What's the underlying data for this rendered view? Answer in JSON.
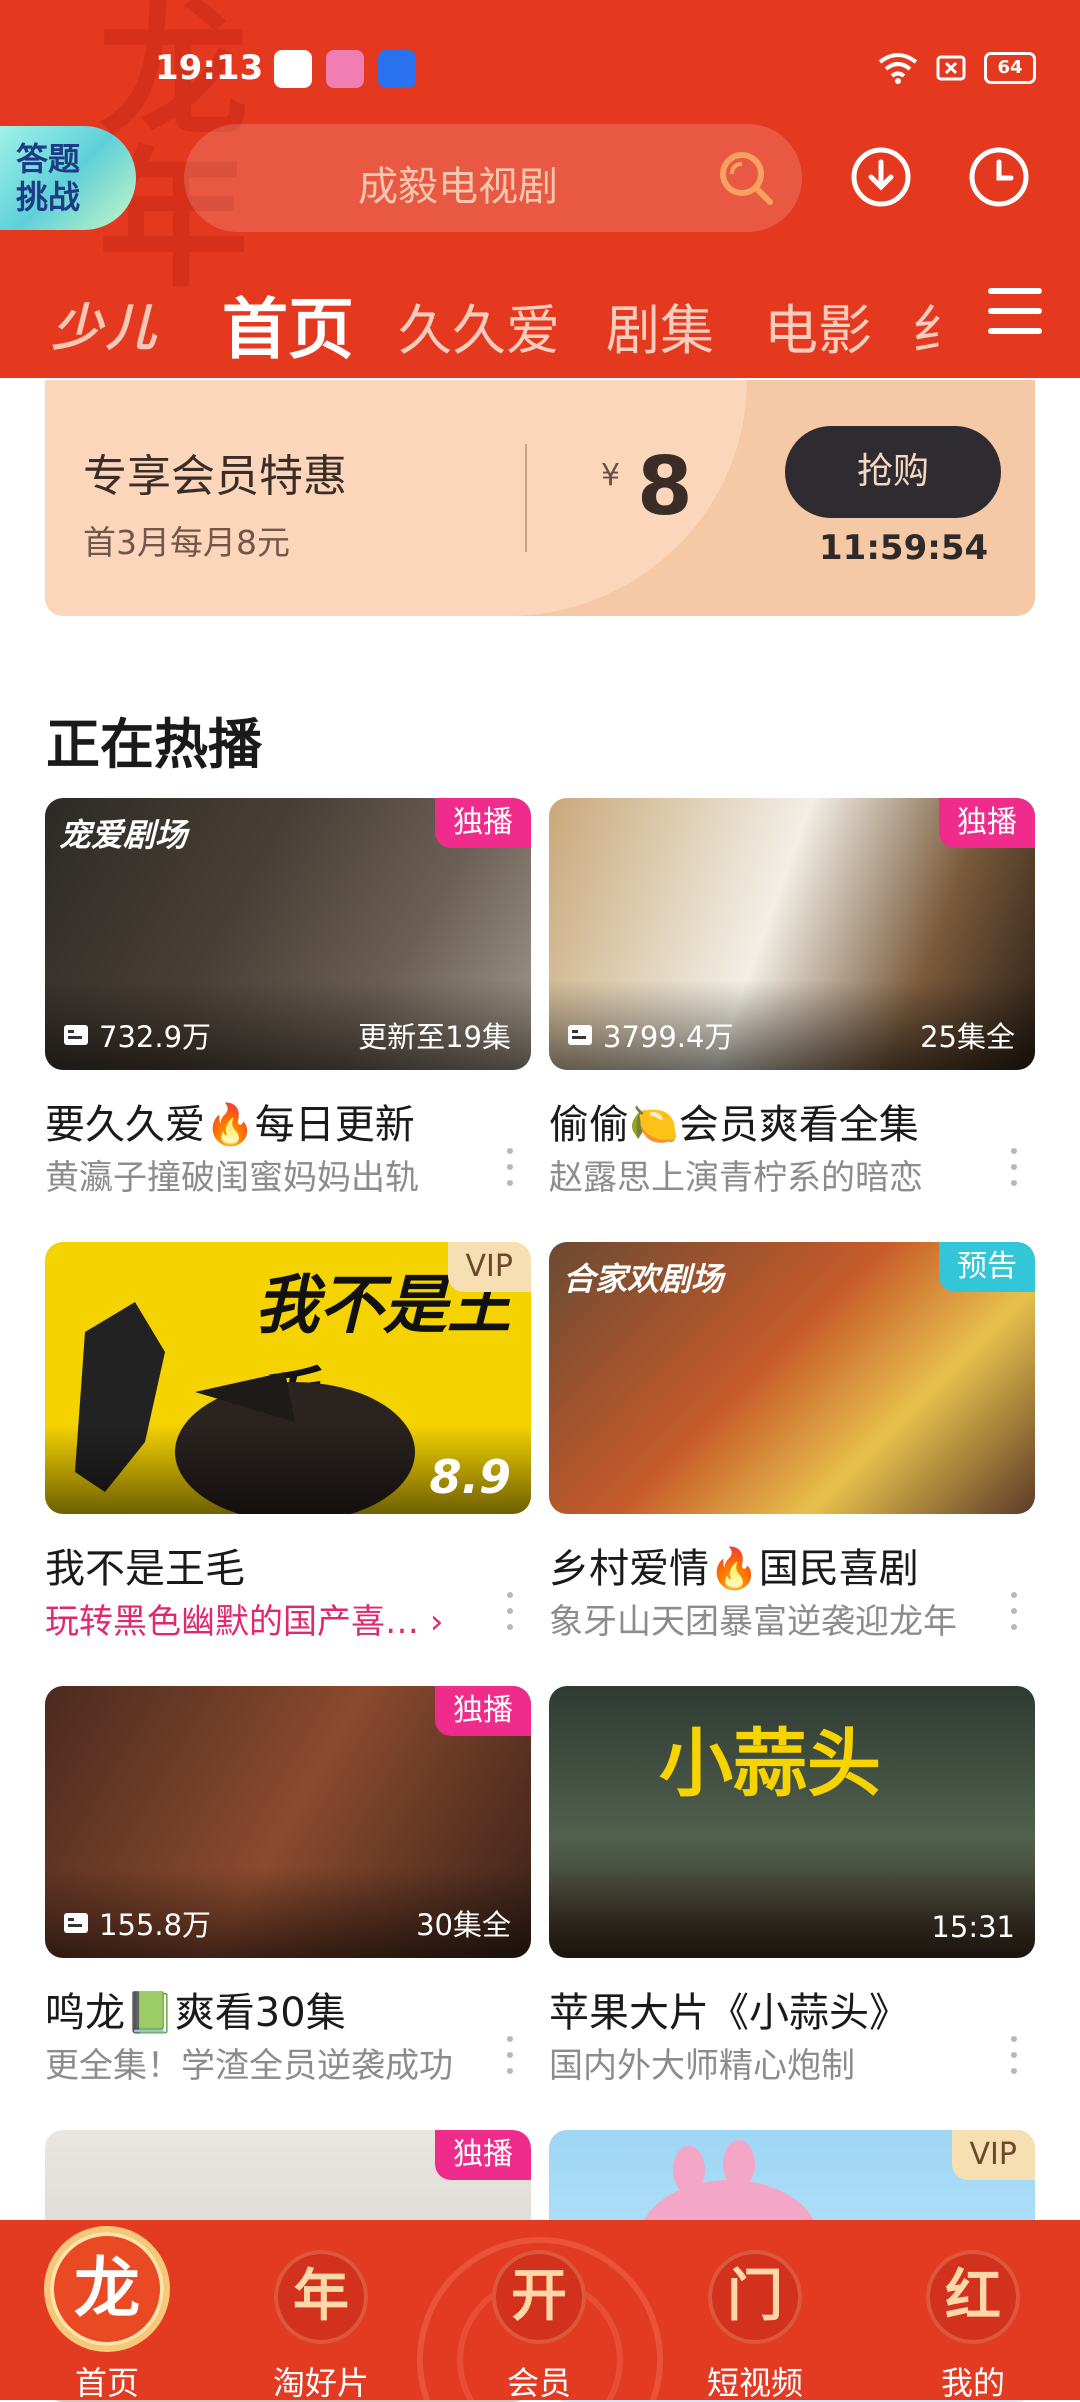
{
  "status_bar": {
    "time": "19:13",
    "battery": "64",
    "icons": [
      "wifi-icon",
      "sim-off-icon",
      "battery-icon"
    ]
  },
  "header": {
    "quiz_badge": [
      "答题",
      "挑战"
    ],
    "search_placeholder": "成毅电视剧",
    "logo": "少儿",
    "tabs": [
      "首页",
      "久久爱",
      "剧集",
      "电影",
      "纟"
    ],
    "active_tab": 0
  },
  "vip_banner": {
    "title": "专享会员特惠",
    "subtitle": "首3月每月8元",
    "price_symbol": "¥",
    "price": "8",
    "buy_label": "抢购",
    "countdown": "11:59:54"
  },
  "section_title": "正在热播",
  "cards": [
    {
      "badge": "独播",
      "views": "732.9万",
      "status": "更新至19集",
      "title": "要久久爱🔥每日更新",
      "subtitle": "黄瀛子撞破闺蜜妈妈出轨",
      "overlay": "宠爱剧场"
    },
    {
      "badge": "独播",
      "views": "3799.4万",
      "status": "25集全",
      "title": "偷偷🍋会员爽看全集",
      "subtitle": "赵露思上演青柠系的暗恋",
      "overlay": ""
    },
    {
      "badge": "VIP",
      "score": "8.9",
      "title": "我不是王毛",
      "subtitle": "玩转黑色幽默的国产喜…",
      "overlay": "我不是王毛"
    },
    {
      "badge": "预告",
      "title": "乡村爱情🔥国民喜剧",
      "subtitle": "象牙山天团暴富逆袭迎龙年",
      "overlay": "合家欢剧场"
    },
    {
      "badge": "独播",
      "views": "155.8万",
      "status": "30集全",
      "title": "鸣龙📗爽看30集",
      "subtitle": "更全集！学渣全员逆袭成功",
      "overlay": ""
    },
    {
      "status": "15:31",
      "title": "苹果大片《小蒜头》",
      "subtitle": "国内外大师精心炮制",
      "overlay": "小蒜头"
    },
    {
      "badge": "独播"
    },
    {
      "badge": "VIP"
    }
  ],
  "bottom_nav": [
    {
      "glyph": "龙",
      "label": "首页"
    },
    {
      "glyph": "年",
      "label": "淘好片"
    },
    {
      "glyph": "开",
      "label": "会员"
    },
    {
      "glyph": "门",
      "label": "短视频"
    },
    {
      "glyph": "红",
      "label": "我的"
    }
  ],
  "colors": {
    "brand_red": "#e4391f",
    "badge_pink": "#ef2c8c",
    "badge_cyan": "#33c5d8",
    "vip_gold": "#f6dfb3"
  }
}
